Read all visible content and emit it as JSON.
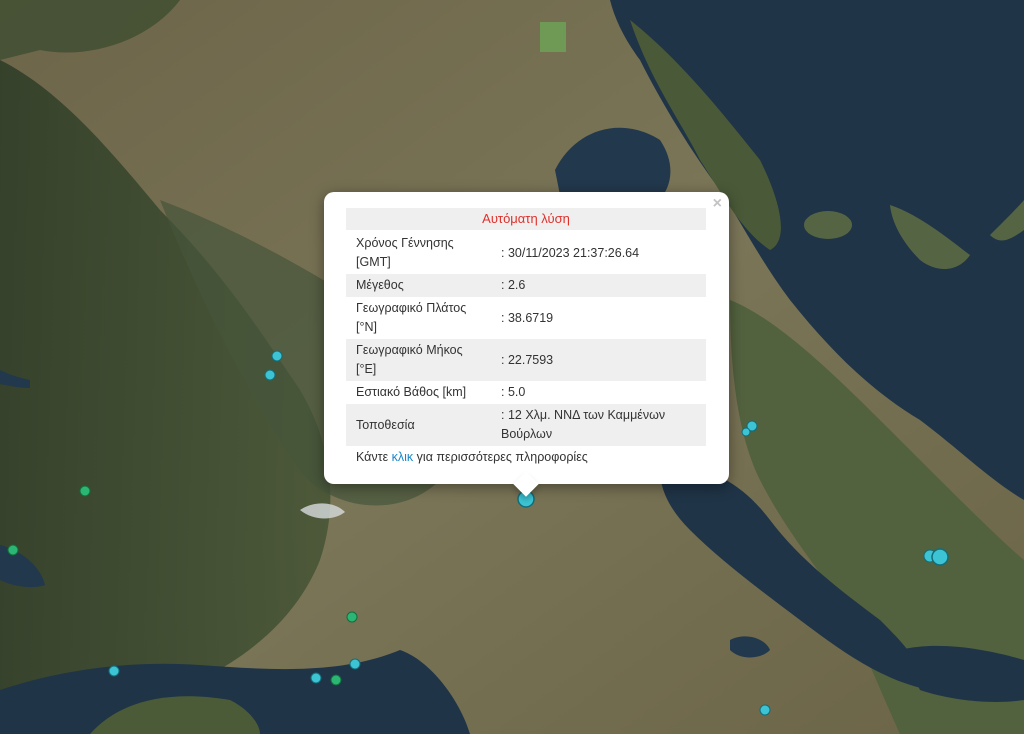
{
  "popup": {
    "title": "Αυτόματη λύση",
    "close_symbol": "×",
    "rows": [
      {
        "label": "Χρόνος Γέννησης [GMT]",
        "value": ": 30/11/2023 21:37:26.64"
      },
      {
        "label": "Μέγεθος",
        "value": ": 2.6"
      },
      {
        "label": "Γεωγραφικό Πλάτος [°N]",
        "value": ": 38.6719"
      },
      {
        "label": "Γεωγραφικό Μήκος [°E]",
        "value": ": 22.7593"
      },
      {
        "label": "Εστιακό Βάθος [km]",
        "value": ": 5.0"
      },
      {
        "label": "Τοποθεσία",
        "value": ": 12 Χλμ. ΝΝΔ των Καμμένων Βούρλων"
      }
    ],
    "more_prefix": "Κάντε ",
    "more_link": "κλικ",
    "more_suffix": " για περισσότερες πληροφορίες"
  },
  "colors": {
    "sea": "#1f3447",
    "land_dark": "#3b4a2e",
    "land_light": "#7a7356",
    "marker_cyan": "#3cc4d4",
    "marker_green": "#2bb673",
    "title_red": "#e0302b",
    "link_blue": "#1a86c8"
  }
}
